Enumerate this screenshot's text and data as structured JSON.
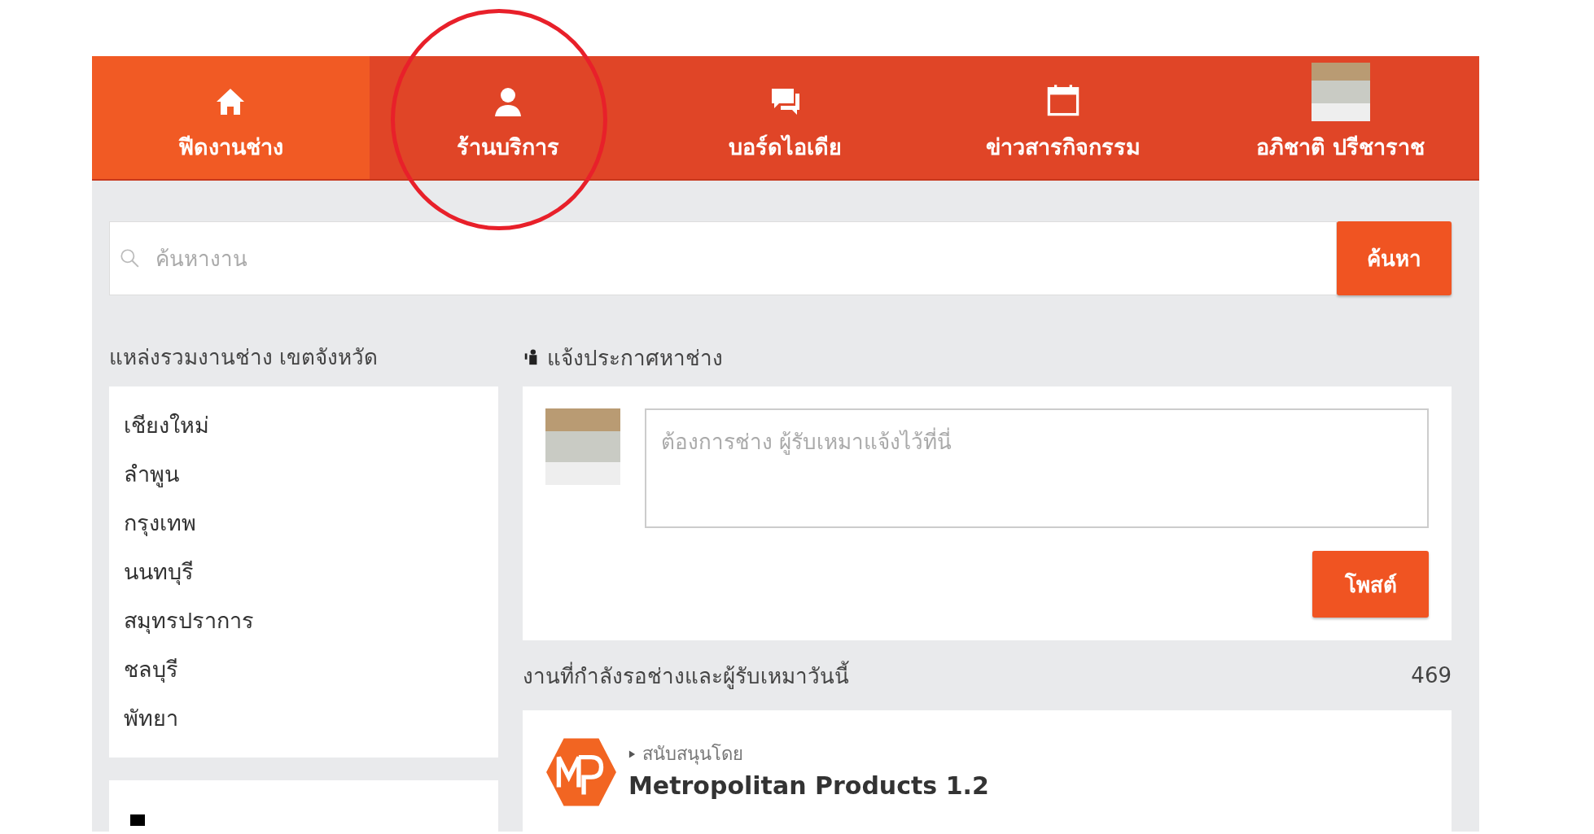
{
  "nav": {
    "tabs": [
      {
        "label": "ฟีดงานช่าง",
        "kind": "home",
        "selected": true
      },
      {
        "label": "ร้านบริการ",
        "kind": "person",
        "selected": false
      },
      {
        "label": "บอร์ดไอเดีย",
        "kind": "chat",
        "selected": false
      },
      {
        "label": "ข่าวสารกิจกรรม",
        "kind": "calendar",
        "selected": false
      },
      {
        "label": "อภิชาติ ปรีชาราช",
        "kind": "avatar",
        "selected": false
      }
    ]
  },
  "search": {
    "placeholder": "ค้นหางาน",
    "button": "ค้นหา"
  },
  "sidebar": {
    "title": "แหล่งรวมงานช่าง เขตจังหวัด",
    "items": [
      "เชียงใหม่",
      "ลำพูน",
      "กรุงเทพ",
      "นนทบุรี",
      "สมุทรปราการ",
      "ชลบุรี",
      "พัทยา"
    ]
  },
  "post": {
    "title": "แจ้งประกาศหาช่าง",
    "placeholder": "ต้องการช่าง ผู้รับเหมาแจ้งไว้ที่นี่",
    "button": "โพสต์"
  },
  "jobs": {
    "title": "งานที่กำลังรอช่างและผู้รับเหมาวันนี้",
    "count": "469"
  },
  "sponsor": {
    "label": "สนับสนุนโดย",
    "name": "Metropolitan Products 1.2"
  }
}
